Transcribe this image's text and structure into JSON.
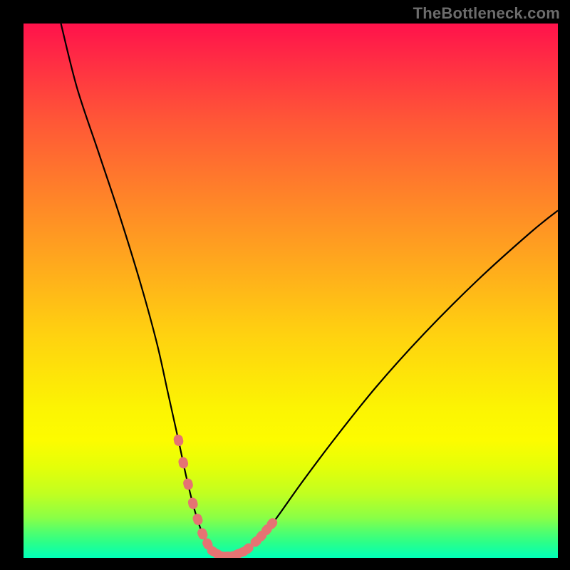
{
  "watermark": "TheBottleneck.com",
  "chart_data": {
    "type": "line",
    "title": "",
    "xlabel": "",
    "ylabel": "",
    "xlim": [
      0,
      100
    ],
    "ylim": [
      0,
      100
    ],
    "grid": false,
    "legend": false,
    "series": [
      {
        "name": "bottleneck-curve",
        "color": "#000000",
        "x": [
          7,
          10,
          14,
          18,
          22,
          25,
          27,
          29,
          30.5,
          32,
          33.5,
          35,
          37,
          39,
          41.5,
          44,
          47,
          52,
          58,
          66,
          75,
          85,
          95,
          100
        ],
        "y": [
          100,
          88,
          76,
          64,
          51,
          40,
          31,
          22,
          15,
          9,
          4.5,
          1.5,
          0.3,
          0.3,
          1.3,
          3.5,
          7,
          14,
          22,
          32,
          42,
          52,
          61,
          65
        ]
      }
    ],
    "markers": [
      {
        "name": "highlight-segment-left",
        "x_range": [
          29.0,
          33.5
        ],
        "color": "#e57373"
      },
      {
        "name": "highlight-segment-floor",
        "x_range": [
          33.5,
          42.0
        ],
        "color": "#e57373"
      },
      {
        "name": "highlight-segment-right",
        "x_range": [
          43.5,
          46.5
        ],
        "color": "#e57373"
      }
    ],
    "background": {
      "type": "vertical-gradient",
      "stops": [
        {
          "pos": 0,
          "color": "#ff124b"
        },
        {
          "pos": 0.72,
          "color": "#fcf403"
        },
        {
          "pos": 1.0,
          "color": "#00ffb8"
        }
      ]
    }
  }
}
